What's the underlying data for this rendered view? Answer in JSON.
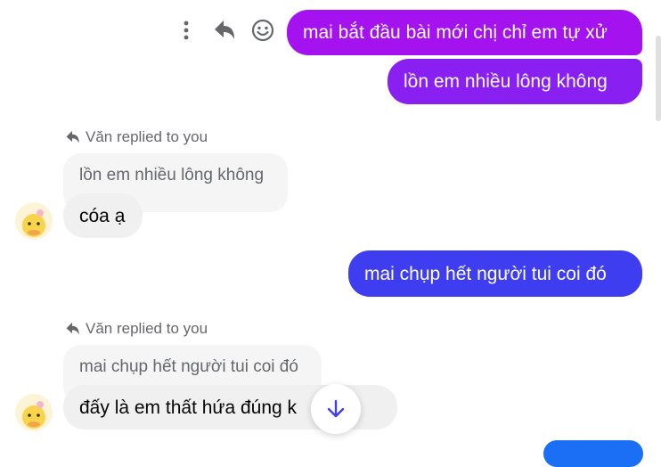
{
  "messages": {
    "outgoing_1": "mai bắt đầu bài mới chị chỉ em tự xử",
    "outgoing_2": "lồn em nhiều lông không",
    "outgoing_3": "mai chụp hết người tui coi đó",
    "reply_1": {
      "label": "Văn replied to you",
      "quoted": "lồn em nhiều lông không",
      "text": "cóa ạ"
    },
    "reply_2": {
      "label": "Văn replied to you",
      "quoted": "mai chụp hết người tui coi đó",
      "text": "đấy là em thất hứa đúng k     chị"
    }
  },
  "icons": {
    "more": "more-vertical-icon",
    "reply": "reply-icon",
    "react": "smiley-icon",
    "scroll_down": "arrow-down-icon",
    "avatar": "duck-avatar"
  },
  "colors": {
    "outgoing_1": "#a512f0",
    "outgoing_2": "#8a1ff2",
    "outgoing_3": "#3f3df0",
    "incoming": "#f0f0f0",
    "accent": "#1a6ff5"
  }
}
